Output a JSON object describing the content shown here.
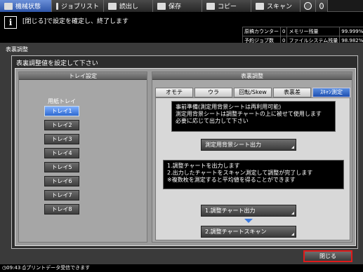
{
  "top_tabs": [
    {
      "label": "機械状態",
      "icon": "machine-icon",
      "active": true
    },
    {
      "label": "ジョブリスト",
      "icon": "job-list-icon",
      "active": false
    },
    {
      "label": "読出し",
      "icon": "recall-icon",
      "active": false
    },
    {
      "label": "保存",
      "icon": "save-icon",
      "active": false
    },
    {
      "label": "コピー",
      "icon": "copy-icon",
      "active": false
    },
    {
      "label": "スキャン",
      "icon": "scan-icon",
      "active": false
    }
  ],
  "top_icons": [
    "globe-icon",
    "power-icon"
  ],
  "message": "[閉じる]で設定を確定し、終了します",
  "counters": [
    {
      "label": "原稿カウンター",
      "value": "0",
      "label2": "メモリー残量",
      "value2": "99.999%"
    },
    {
      "label": "予約ジョブ数",
      "value": "0",
      "label2": "ファイルシステム残量",
      "value2": "98.982%"
    }
  ],
  "screen_title": "表裏調整",
  "instruction": "表裏調整値を設定して下さい",
  "left_panel": {
    "header": "トレイ設定",
    "caption": "用紙トレイ",
    "trays": [
      "トレイ1",
      "トレイ2",
      "トレイ3",
      "トレイ4",
      "トレイ5",
      "トレイ6",
      "トレイ7",
      "トレイ8"
    ],
    "selected_tray": "トレイ1"
  },
  "right_panel": {
    "header": "表裏調整",
    "tabs": [
      "オモテ",
      "ウラ",
      "回転/Skew",
      "表裏差",
      "ｽｷｬﾝ測定"
    ],
    "active_tab": "ｽｷｬﾝ測定",
    "note1": [
      "事前準備(測定用背景シートは再利用可能)",
      "測定用背景シートは調整チャートの上に被せて使用します",
      "必要に応じて出力して下さい"
    ],
    "btn_background_sheet": "測定用背景シート出力",
    "note2": [
      "1.調整チャートを出力します",
      "2.出力したチャートをスキャン測定して調整が完了します",
      "※複数枚を測定すると平均値を得ることができます"
    ],
    "btn_output_chart": "1.調整チャート出力",
    "btn_scan_chart": "2.調整チャートスキャン"
  },
  "close_button": "閉じる",
  "status": {
    "time": "09:43",
    "text": "プリントデータ受信できます"
  }
}
